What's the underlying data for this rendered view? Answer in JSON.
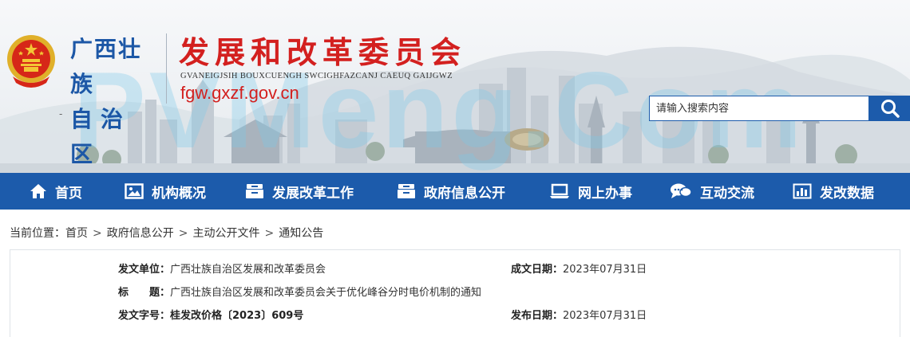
{
  "header": {
    "region_line1": "广西壮族",
    "region_line2": "自治区",
    "org_title": "发展和改革委员会",
    "org_subtitle": "GVANEIGJSIH BOUXCUENGH SWCIGHFAZCANJ CAEUQ GAIJGWZ",
    "site_url": "fgw.gxzf.gov.cn",
    "small_mark": "-",
    "watermark": "PVMeng.Com",
    "search": {
      "placeholder": "请输入搜索内容"
    }
  },
  "nav": {
    "items": [
      {
        "label": "首页",
        "icon": "home-icon"
      },
      {
        "label": "机构概况",
        "icon": "picture-icon"
      },
      {
        "label": "发展改革工作",
        "icon": "cabinet-icon"
      },
      {
        "label": "政府信息公开",
        "icon": "cabinet-icon"
      },
      {
        "label": "网上办事",
        "icon": "laptop-icon"
      },
      {
        "label": "互动交流",
        "icon": "chat-icon"
      },
      {
        "label": "发改数据",
        "icon": "bar-chart-icon"
      }
    ]
  },
  "breadcrumb": {
    "prefix": "当前位置：",
    "items": [
      "首页",
      "政府信息公开",
      "主动公开文件",
      "通知公告"
    ],
    "separator": ">"
  },
  "document": {
    "issuer_label": "发文单位：",
    "issuer": "广西壮族自治区发展和改革委员会",
    "created_label": "成文日期：",
    "created": "2023年07月31日",
    "title_label": "标　　题：",
    "title": "广西壮族自治区发展和改革委员会关于优化峰谷分时电价机制的通知",
    "docno_label": "发文字号：",
    "docno": "桂发改价格〔2023〕609号",
    "published_label": "发布日期：",
    "published": "2023年07月31日"
  },
  "colors": {
    "nav_blue": "#1c5bab",
    "title_red": "#d3201f",
    "region_blue": "#1c57a6"
  }
}
